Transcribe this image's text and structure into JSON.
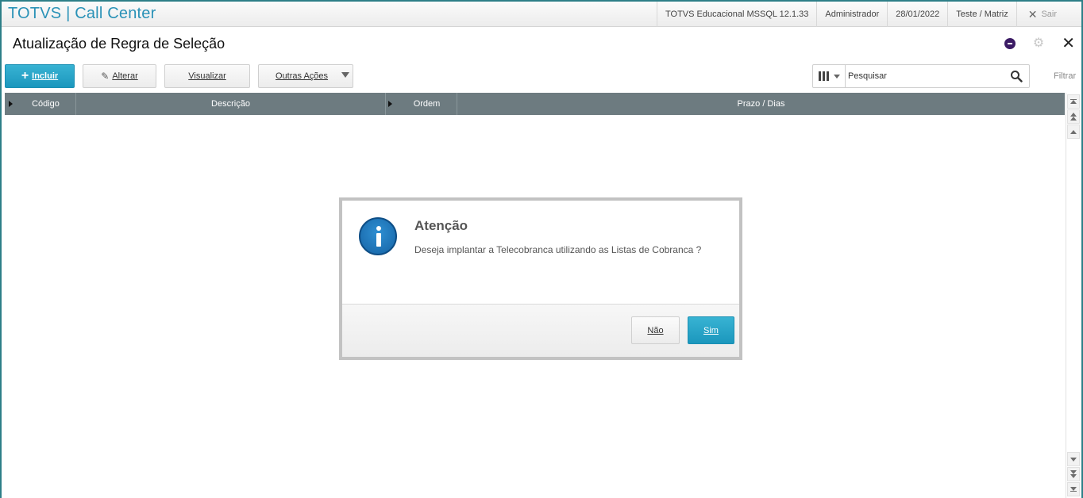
{
  "window": {
    "app_title": "TOTVS | Call Center",
    "info": [
      "TOTVS Educacional MSSQL 12.1.33",
      "Administrador",
      "28/01/2022",
      "Teste / Matriz"
    ],
    "exit_label": "Sair"
  },
  "page": {
    "title": "Atualização de Regra de Seleção"
  },
  "toolbar": {
    "include_label": "Incluir",
    "alter_label": "Alterar",
    "view_label": "Visualizar",
    "other_actions_label": "Outras Ações"
  },
  "search": {
    "placeholder": "Pesquisar",
    "filter_label": "Filtrar"
  },
  "grid": {
    "columns": [
      "Código",
      "Descrição",
      "Ordem",
      "Prazo / Dias"
    ]
  },
  "dialog": {
    "title": "Atenção",
    "message": "Deseja implantar a Telecobranca utilizando as Listas de Cobranca ?",
    "no_label": "Não",
    "yes_label": "Sim"
  },
  "colors": {
    "accent": "#1b97bd",
    "title_blue": "#2a92b7",
    "grid_header": "#6d7b80",
    "frame": "#2d7f88"
  }
}
